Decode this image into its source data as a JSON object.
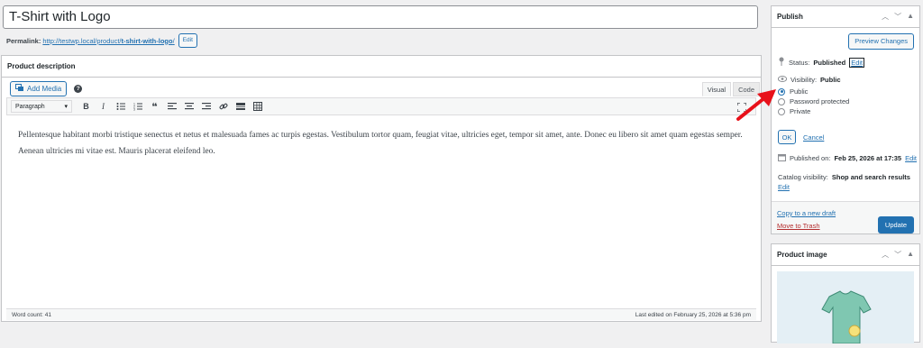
{
  "title": {
    "value": "T-Shirt with Logo"
  },
  "permalink": {
    "label": "Permalink:",
    "base": "http://testwp.local/product/",
    "slug": "t-shirt-with-logo",
    "trail": "/",
    "edit_label": "Edit"
  },
  "description": {
    "header": "Product description",
    "add_media_label": "Add Media",
    "help_glyph": "?",
    "tabs": [
      {
        "label": "Visual"
      },
      {
        "label": "Code"
      }
    ],
    "format_select": "Paragraph",
    "toolbar_icons": [
      "bold-icon",
      "italic-icon",
      "bullet-list-icon",
      "numbered-list-icon",
      "blockquote-icon",
      "align-left-icon",
      "align-center-icon",
      "align-right-icon",
      "link-icon",
      "read-more-icon",
      "toolbar-toggle-icon",
      "fullscreen-icon"
    ],
    "content": "Pellentesque habitant morbi tristique senectus et netus et malesuada fames ac turpis egestas. Vestibulum tortor quam, feugiat vitae, ultricies eget, tempor sit amet, ante. Donec eu libero sit amet quam egestas semper. Aenean ultricies mi vitae est. Mauris placerat eleifend leo.",
    "word_count": "Word count: 41",
    "last_edited": "Last edited on February 25, 2026 at 5:36 pm"
  },
  "publish": {
    "header": "Publish",
    "preview_label": "Preview Changes",
    "status_label": "Status:",
    "status_value": "Published",
    "status_edit": "Edit",
    "visibility_label": "Visibility:",
    "visibility_value": "Public",
    "options": [
      {
        "label": "Public",
        "checked": true
      },
      {
        "label": "Password protected",
        "checked": false
      },
      {
        "label": "Private",
        "checked": false
      }
    ],
    "ok_label": "OK",
    "cancel_label": "Cancel",
    "published_label": "Published on:",
    "published_value": "Feb 25, 2026 at 17:35",
    "published_edit": "Edit",
    "catalog_label": "Catalog visibility:",
    "catalog_value": "Shop and search results",
    "catalog_edit": "Edit",
    "copy_draft": "Copy to a new draft",
    "trash": "Move to Trash",
    "update_label": "Update"
  },
  "product_image": {
    "header": "Product image"
  },
  "colors": {
    "accent": "#2271b1",
    "danger": "#b32d2e",
    "arrow": "#e8111a"
  }
}
